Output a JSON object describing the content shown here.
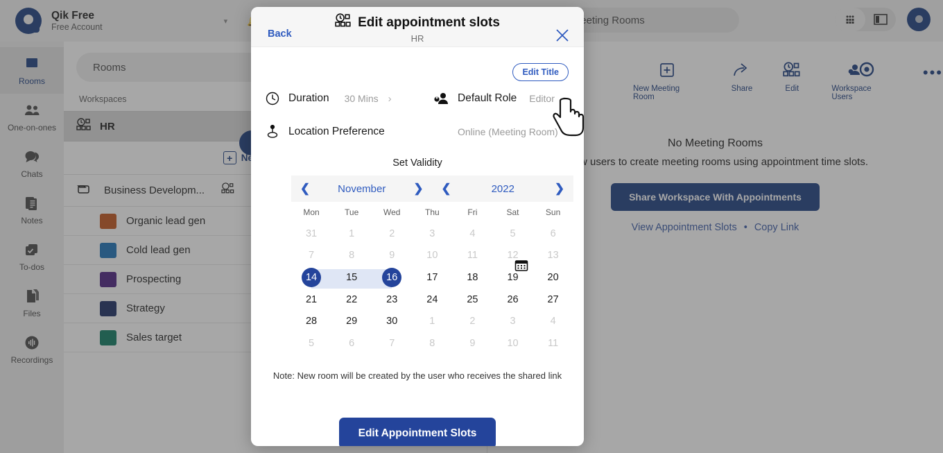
{
  "app": {
    "brand_title": "Qik Free",
    "brand_subtitle": "Free Account",
    "breadcrumb": "Workspaces / Meeting Rooms",
    "caret": "▾"
  },
  "sidebar": {
    "items": [
      {
        "label": "Rooms",
        "icon": "rooms-icon",
        "active": true
      },
      {
        "label": "One-on-ones",
        "icon": "people-icon",
        "active": false
      },
      {
        "label": "Chats",
        "icon": "chat-icon",
        "active": false
      },
      {
        "label": "Notes",
        "icon": "notes-icon",
        "active": false
      },
      {
        "label": "To-dos",
        "icon": "checkbox-icon",
        "active": false
      },
      {
        "label": "Files",
        "icon": "files-icon",
        "active": false
      },
      {
        "label": "Recordings",
        "icon": "recordings-icon",
        "active": false
      }
    ]
  },
  "list_panel": {
    "search_value": "Rooms",
    "workspaces_label": "Workspaces",
    "workspace_name": "HR",
    "new_meeting_room_label": "New Meeting Room",
    "folder_name": "Business Developm...",
    "rooms": [
      {
        "name": "Organic lead gen",
        "color": "#c2551d"
      },
      {
        "name": "Cold lead gen",
        "color": "#1b72b8"
      },
      {
        "name": "Prospecting",
        "color": "#4b2080"
      },
      {
        "name": "Strategy",
        "color": "#1b2d63"
      },
      {
        "name": "Sales target",
        "color": "#0d7a62"
      }
    ]
  },
  "right_panel": {
    "toolbar": [
      {
        "label": "New Meeting Room",
        "icon": "plus-square-icon"
      },
      {
        "label": "Share",
        "icon": "share-arrow-icon"
      },
      {
        "label": "Edit",
        "icon": "appointment-slots-icon"
      },
      {
        "label": "Workspace Users",
        "icon": "workspace-users-icon"
      }
    ],
    "more_label": "•••",
    "empty_title": "No Meeting Rooms",
    "empty_subtitle": "Allow users to create meeting rooms using appointment time slots.",
    "share_button": "Share Workspace With Appointments",
    "link_view_slots": "View Appointment Slots",
    "link_separator": "•",
    "link_copy": "Copy Link"
  },
  "modal": {
    "back_label": "Back",
    "title": "Edit appointment slots",
    "subtitle": "HR",
    "close_icon": "close-icon",
    "edit_title_button": "Edit Title",
    "options": [
      {
        "label": "Duration",
        "value": "30 Mins",
        "icon": "clock-icon",
        "chevron": "›"
      },
      {
        "label": "Default Role",
        "value": "Editor",
        "icon": "user-role-icon",
        "chevron": "›"
      },
      {
        "label": "Location Preference",
        "value": "Online (Meeting Room)",
        "icon": "location-pin-icon",
        "chevron": ""
      }
    ],
    "set_validity_label": "Set Validity",
    "calendar": {
      "prev_month_icon": "chevron-left-icon",
      "next_month_icon": "chevron-right-icon",
      "month": "November",
      "prev_year_icon": "chevron-left-icon",
      "next_year_icon": "chevron-right-icon",
      "year": "2022",
      "day_names": [
        "Mon",
        "Tue",
        "Wed",
        "Thu",
        "Fri",
        "Sat",
        "Sun"
      ],
      "weeks": [
        [
          {
            "d": "31",
            "muted": true
          },
          {
            "d": "1",
            "muted": true
          },
          {
            "d": "2",
            "muted": true
          },
          {
            "d": "3",
            "muted": true
          },
          {
            "d": "4",
            "muted": true
          },
          {
            "d": "5",
            "muted": true
          },
          {
            "d": "6",
            "muted": true
          }
        ],
        [
          {
            "d": "7",
            "muted": true
          },
          {
            "d": "8",
            "muted": true
          },
          {
            "d": "9",
            "muted": true
          },
          {
            "d": "10",
            "muted": true
          },
          {
            "d": "11",
            "muted": true
          },
          {
            "d": "12",
            "muted": true
          },
          {
            "d": "13",
            "muted": true
          }
        ],
        [
          {
            "d": "14",
            "muted": false,
            "selected": true,
            "range": "start"
          },
          {
            "d": "15",
            "muted": false,
            "range": "mid"
          },
          {
            "d": "16",
            "muted": false,
            "selected": true,
            "range": "end"
          },
          {
            "d": "17",
            "muted": false
          },
          {
            "d": "18",
            "muted": false
          },
          {
            "d": "19",
            "muted": false
          },
          {
            "d": "20",
            "muted": false
          }
        ],
        [
          {
            "d": "21",
            "muted": false
          },
          {
            "d": "22",
            "muted": false
          },
          {
            "d": "23",
            "muted": false
          },
          {
            "d": "24",
            "muted": false
          },
          {
            "d": "25",
            "muted": false
          },
          {
            "d": "26",
            "muted": false
          },
          {
            "d": "27",
            "muted": false
          }
        ],
        [
          {
            "d": "28",
            "muted": false
          },
          {
            "d": "29",
            "muted": false
          },
          {
            "d": "30",
            "muted": false
          },
          {
            "d": "1",
            "muted": true
          },
          {
            "d": "2",
            "muted": true
          },
          {
            "d": "3",
            "muted": true
          },
          {
            "d": "4",
            "muted": true
          }
        ],
        [
          {
            "d": "5",
            "muted": true
          },
          {
            "d": "6",
            "muted": true
          },
          {
            "d": "7",
            "muted": true
          },
          {
            "d": "8",
            "muted": true
          },
          {
            "d": "9",
            "muted": true
          },
          {
            "d": "10",
            "muted": true
          },
          {
            "d": "11",
            "muted": true
          }
        ]
      ]
    },
    "note": "Note: New room will be created by the user who receives the shared link",
    "cta_label": "Edit Appointment Slots"
  },
  "colors": {
    "accent_blue": "#24449b",
    "link_blue": "#2f5bbf",
    "brand_navy": "#1d3e80",
    "range_highlight": "#dfe6f5"
  }
}
